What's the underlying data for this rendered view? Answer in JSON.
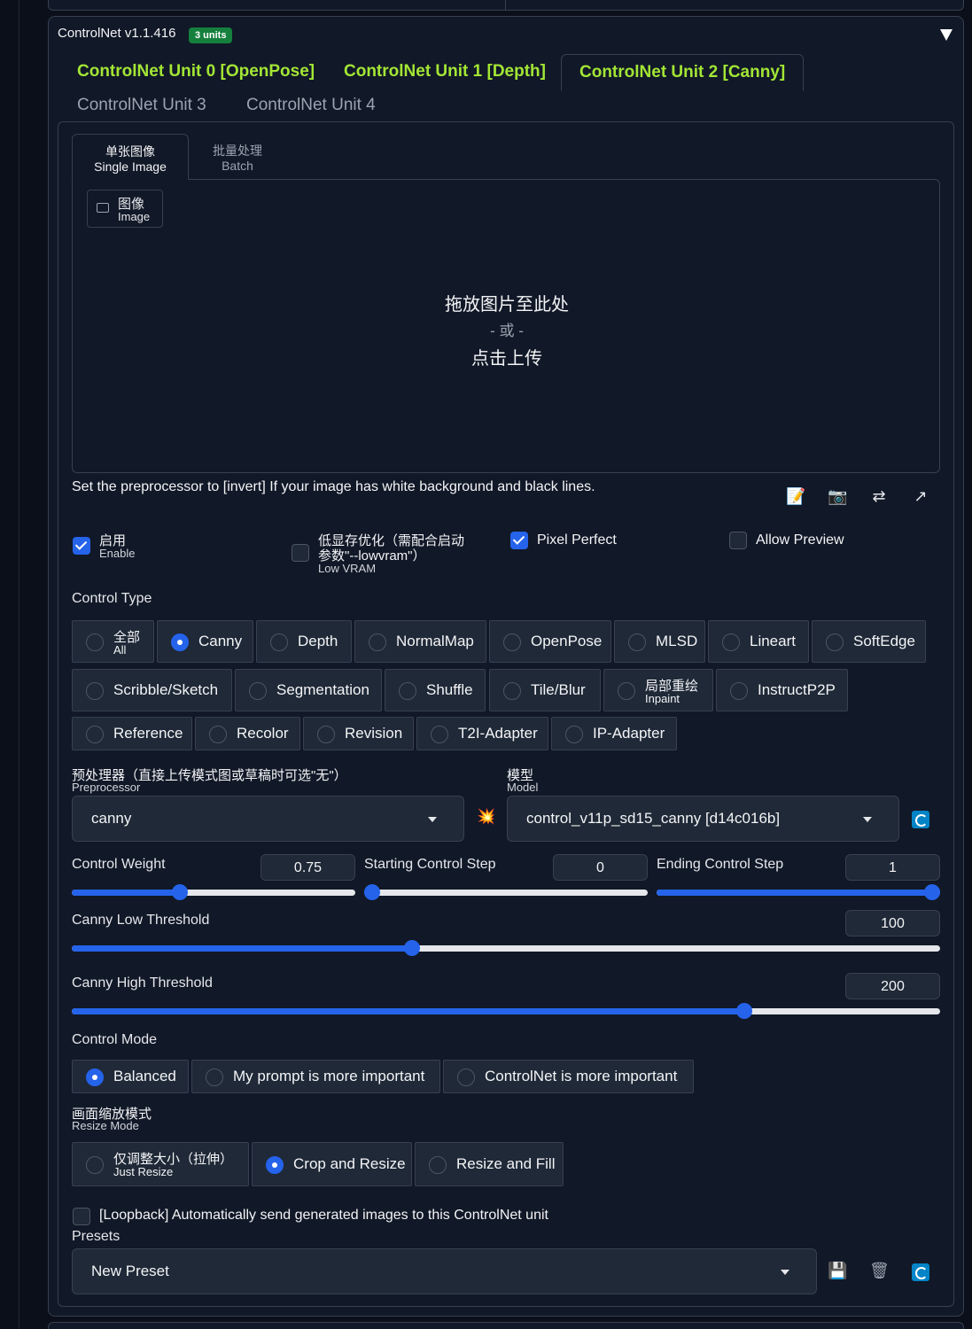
{
  "header": {
    "title": "ControlNet v1.1.416",
    "badge": "3 units"
  },
  "unit_tabs": [
    {
      "label": "ControlNet Unit 0 [OpenPose]"
    },
    {
      "label": "ControlNet Unit 1 [Depth]"
    },
    {
      "label": "ControlNet Unit 2 [Canny]",
      "active": true
    },
    {
      "label": "ControlNet Unit 3"
    },
    {
      "label": "ControlNet Unit 4"
    }
  ],
  "mode_tabs": [
    {
      "zh": "单张图像",
      "en": "Single Image",
      "active": true
    },
    {
      "zh": "批量处理",
      "en": "Batch"
    }
  ],
  "image_chip": {
    "zh": "图像",
    "en": "Image"
  },
  "drop_zone": {
    "line1": "拖放图片至此处",
    "line2": "- 或 -",
    "line3": "点击上传"
  },
  "hint": "Set the preprocessor to [invert] If your image has white background and black lines.",
  "tools": {
    "edit": "📝",
    "camera": "📷",
    "swap": "⇄",
    "send": "↗"
  },
  "options": {
    "enable": {
      "zh": "启用",
      "en": "Enable",
      "checked": true
    },
    "lowvram": {
      "zh1": "低显存优化（需配合启动",
      "zh2": "参数\"--lowvram\"）",
      "en": "Low VRAM",
      "checked": false
    },
    "pixel_perfect": {
      "label": "Pixel Perfect",
      "checked": true
    },
    "allow_preview": {
      "label": "Allow Preview",
      "checked": false
    }
  },
  "control_type": {
    "label": "Control Type",
    "all": {
      "zh": "全部",
      "en": "All"
    },
    "canny": "Canny",
    "depth": "Depth",
    "normalmap": "NormalMap",
    "openpose": "OpenPose",
    "mlsd": "MLSD",
    "lineart": "Lineart",
    "softedge": "SoftEdge",
    "scribble": "Scribble/Sketch",
    "segmentation": "Segmentation",
    "shuffle": "Shuffle",
    "tileblur": "Tile/Blur",
    "inpaint": {
      "zh": "局部重绘",
      "en": "Inpaint"
    },
    "instructp2p": "InstructP2P",
    "reference": "Reference",
    "recolor": "Recolor",
    "revision": "Revision",
    "t2iadapter": "T2I-Adapter",
    "ipadapter": "IP-Adapter",
    "selected": "Canny"
  },
  "preprocessor": {
    "label_zh": "预处理器（直接上传模式图或草稿时可选\"无\"）",
    "label_en": "Preprocessor",
    "value": "canny",
    "run_icon": "💥"
  },
  "model": {
    "label_zh": "模型",
    "label_en": "Model",
    "value": "control_v11p_sd15_canny [d14c016b]"
  },
  "weights": {
    "control_weight": {
      "label": "Control Weight",
      "value": "0.75",
      "min": 0,
      "max": 2,
      "fraction": 0.375
    },
    "start_step": {
      "label": "Starting Control Step",
      "value": "0",
      "fraction": 0
    },
    "end_step": {
      "label": "Ending Control Step",
      "value": "1",
      "fraction": 1
    }
  },
  "canny_low": {
    "label": "Canny Low Threshold",
    "value": "100",
    "min": 1,
    "max": 255,
    "fraction": 0.39
  },
  "canny_high": {
    "label": "Canny High Threshold",
    "value": "200",
    "min": 1,
    "max": 255,
    "fraction": 0.78
  },
  "control_mode": {
    "label": "Control Mode",
    "balanced": "Balanced",
    "prompt": "My prompt is more important",
    "controlnet": "ControlNet is more important",
    "selected": "Balanced"
  },
  "resize_mode": {
    "label_zh": "画面缩放模式",
    "label_en": "Resize Mode",
    "just_resize": {
      "zh": "仅调整大小（拉伸）",
      "en": "Just Resize"
    },
    "crop_resize": "Crop and Resize",
    "resize_fill": "Resize and Fill",
    "selected": "Crop and Resize"
  },
  "loopback": {
    "label": "[Loopback] Automatically send generated images to this ControlNet unit",
    "checked": false
  },
  "presets": {
    "label": "Presets",
    "value": "New Preset",
    "save_icon": "💾",
    "delete_icon": "🗑"
  },
  "colors": {
    "accent": "#2563eb",
    "green_tab": "#a3e635",
    "badge": "#15803d",
    "bg": "#0b0f19",
    "panel": "#111827"
  }
}
